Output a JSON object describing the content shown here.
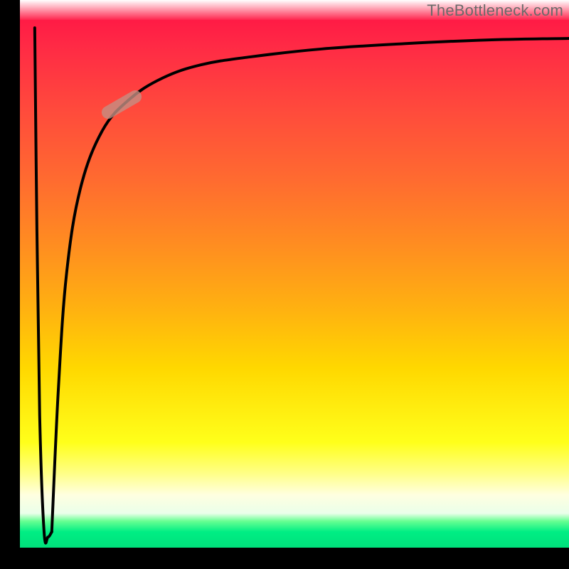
{
  "watermark": "TheBottleneck.com",
  "colors": {
    "axis": "#000000",
    "curve": "#000000",
    "marker": "#c48f83",
    "gradient_top": "#ff1b45",
    "gradient_mid": "#ffd800",
    "gradient_bottom": "#00e07b"
  },
  "marker": {
    "x_pct": 0.185,
    "y_pct": 0.84,
    "angle_deg": -30
  },
  "chart_data": {
    "type": "line",
    "title": "",
    "xlabel": "",
    "ylabel": "",
    "xlim": [
      0,
      1
    ],
    "ylim": [
      0,
      1
    ],
    "series": [
      {
        "name": "left-dip",
        "x": [
          0.027,
          0.031,
          0.036,
          0.044,
          0.051,
          0.058
        ],
        "y": [
          0.985,
          0.6,
          0.25,
          0.03,
          0.02,
          0.03
        ]
      },
      {
        "name": "main-curve",
        "x": [
          0.058,
          0.07,
          0.085,
          0.11,
          0.15,
          0.2,
          0.26,
          0.33,
          0.42,
          0.55,
          0.7,
          0.85,
          1.0
        ],
        "y": [
          0.03,
          0.3,
          0.52,
          0.68,
          0.79,
          0.85,
          0.89,
          0.915,
          0.93,
          0.945,
          0.955,
          0.962,
          0.965
        ]
      }
    ],
    "annotations": [
      {
        "type": "pill-marker",
        "x": 0.185,
        "y": 0.84,
        "rotation_deg": -30
      }
    ]
  }
}
